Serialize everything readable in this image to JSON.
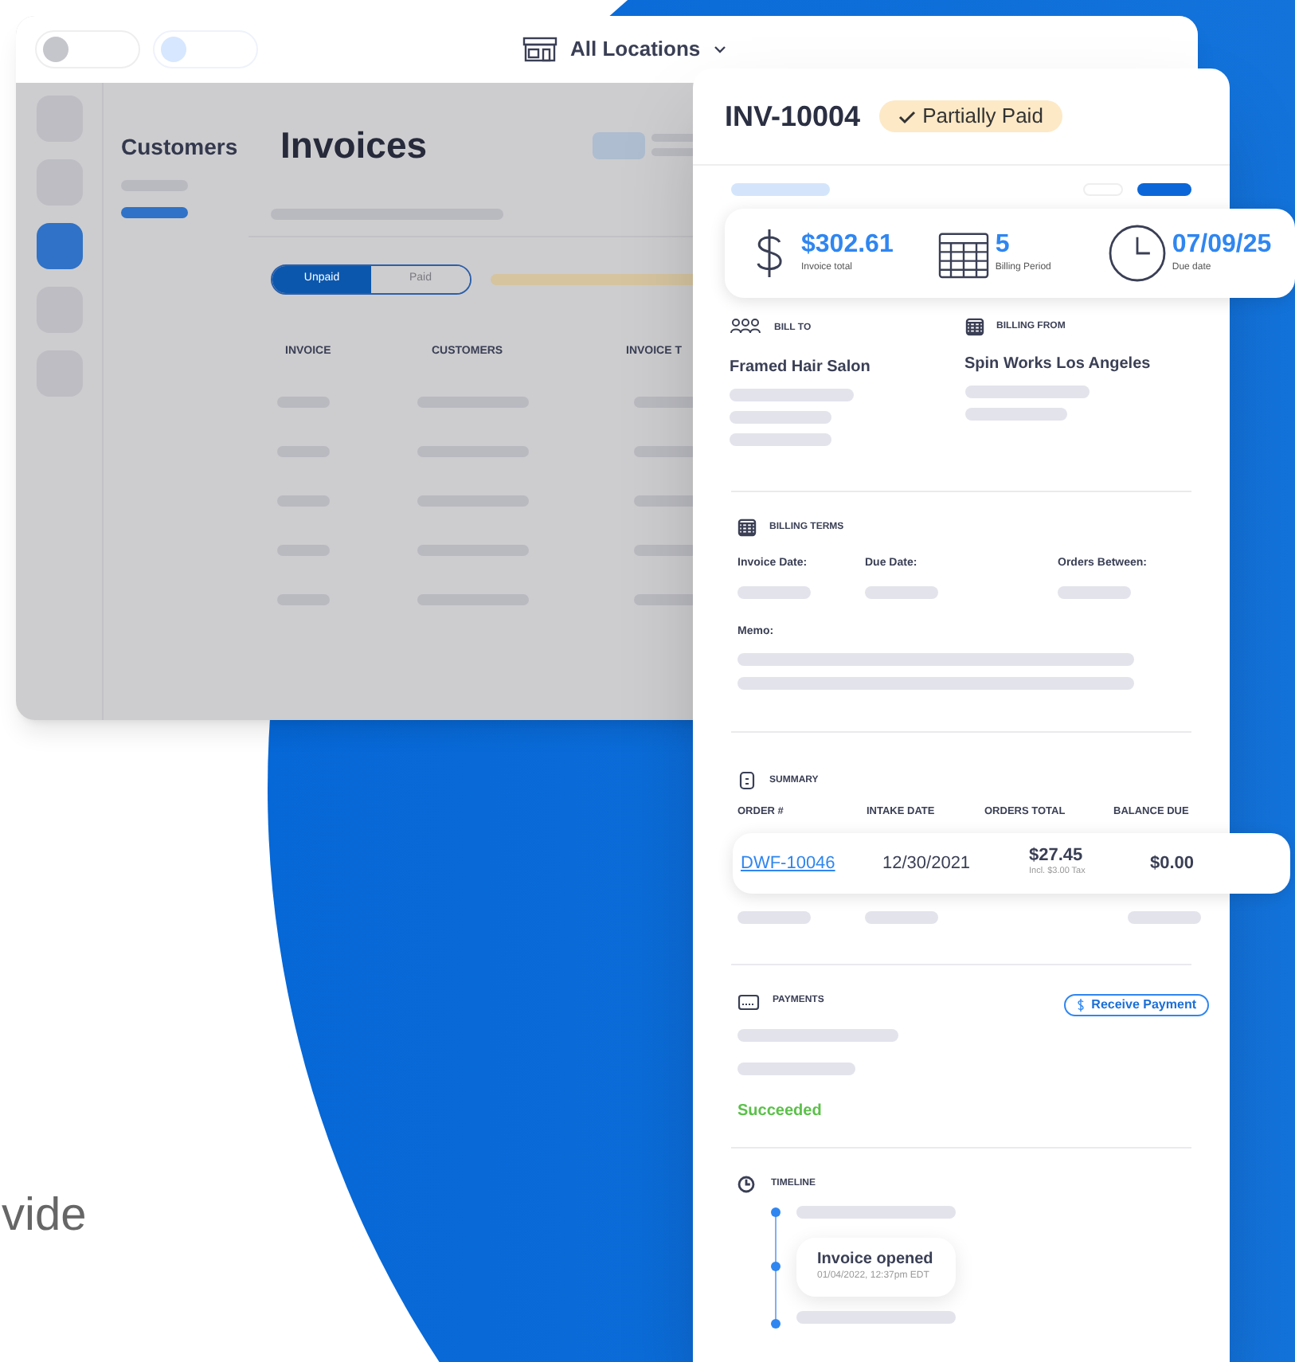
{
  "background_text": "vide",
  "app_window": {
    "location": "All Locations",
    "rail_items": [
      {
        "selected": false
      },
      {
        "selected": false
      },
      {
        "selected": true
      },
      {
        "selected": false
      },
      {
        "selected": false
      }
    ],
    "subnav": {
      "title": "Customers",
      "items": [
        {
          "selected": false
        },
        {
          "selected": true
        }
      ]
    },
    "page_title": "Invoices",
    "filter_tabs": [
      {
        "label": "Unpaid",
        "selected": true
      },
      {
        "label": "Paid",
        "selected": false
      }
    ],
    "columns": [
      "INVOICE",
      "CUSTOMERS",
      "INVOICE T"
    ]
  },
  "invoice_panel": {
    "id": "INV-10004",
    "status": "Partially Paid",
    "stats": [
      {
        "kind": "money",
        "value": "$302.61",
        "label": "Invoice total"
      },
      {
        "kind": "calendar",
        "value": "5",
        "label": "Billing Period"
      },
      {
        "kind": "clock",
        "value": "07/09/25",
        "label": "Due date"
      }
    ],
    "parties": [
      {
        "kind": "people",
        "heading": "BILL TO",
        "name": "Framed Hair Salon"
      },
      {
        "kind": "calendar",
        "heading": "BILLING FROM",
        "name": "Spin Works Los Angeles"
      }
    ],
    "billing_terms": {
      "heading": "BILLING TERMS",
      "fields": [
        "Invoice Date:",
        "Due Date:",
        "Orders Between:"
      ],
      "memo": "Memo:"
    },
    "summary": {
      "heading": "SUMMARY",
      "columns": [
        "ORDER #",
        "INTAKE DATE",
        "ORDERS TOTAL",
        "BALANCE DUE"
      ],
      "row": {
        "order": "DWF-10046",
        "intake_date": "12/30/2021",
        "total": "$27.45",
        "tax": "Incl. $3.00 Tax",
        "balance": "$0.00"
      }
    },
    "payments": {
      "heading": "PAYMENTS",
      "button": "Receive Payment",
      "status": "Succeeded"
    },
    "timeline": {
      "heading": "TIMELINE",
      "event": {
        "title": "Invoice opened",
        "time": "01/04/2022, 12:37pm EDT"
      }
    }
  }
}
